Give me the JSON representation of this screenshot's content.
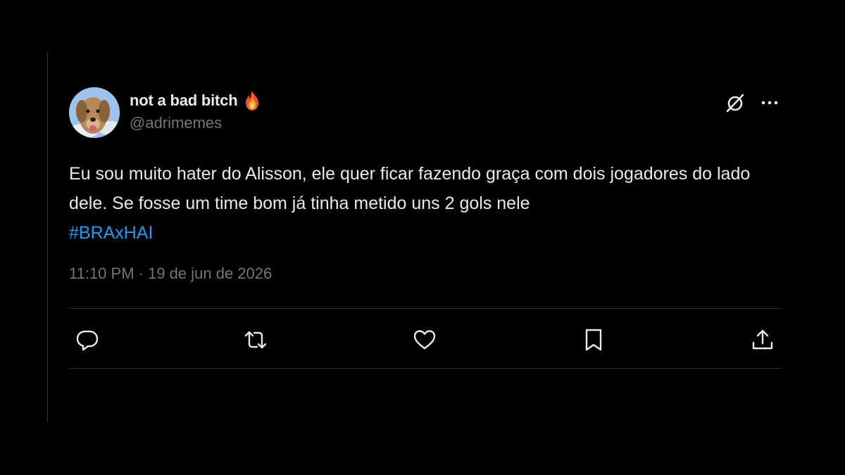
{
  "tweet": {
    "display_name": "not a bad bitch",
    "handle": "@adrimemes",
    "body": "Eu sou muito hater do Alisson, ele quer ficar fazendo graça com dois jogadores do lado dele. Se fosse um time bom já tinha metido uns 2 gols nele",
    "hashtag": "#BRAxHAI",
    "timestamp": "11:10 PM · 19 de jun de 2026"
  },
  "icons": {
    "name_badge": "fire-icon",
    "header_actions": [
      "grok-icon",
      "more-icon"
    ],
    "actions": [
      "reply-icon",
      "retweet-icon",
      "like-icon",
      "bookmark-icon",
      "share-icon"
    ]
  },
  "colors": {
    "background": "#000000",
    "text": "#e7e9ea",
    "muted": "#71767b",
    "link": "#1d9bf0",
    "divider": "#2f3336"
  }
}
